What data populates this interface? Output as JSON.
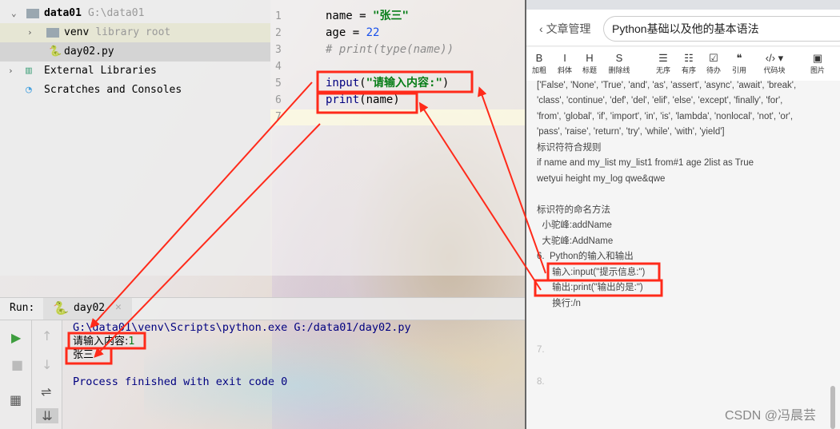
{
  "project": {
    "root": "data01",
    "root_path": "G:\\data01",
    "venv": "venv",
    "venv_hint": "library root",
    "file": "day02.py",
    "ext_libs": "External Libraries",
    "scratches": "Scratches and Consoles"
  },
  "editor": {
    "line_numbers": [
      "1",
      "2",
      "3",
      "4",
      "5",
      "6",
      "7"
    ],
    "lines": [
      {
        "a": "name = ",
        "b": "\"张三\""
      },
      {
        "a": "age = ",
        "b": "22"
      },
      {
        "c": "# print(type(name))"
      },
      {},
      {
        "fn": "input",
        "p": "(",
        "s": "\"请输入内容:\"",
        "q": ")"
      },
      {
        "fn": "print",
        "p": "(name)"
      }
    ]
  },
  "run": {
    "label": "Run:",
    "tab": "day02",
    "cmd": "G:\\data01\\venv\\Scripts\\python.exe G:/data01/day02.py",
    "prompt": "请输入内容:",
    "input": "1",
    "output": "张三",
    "exit": "Process finished with exit code 0"
  },
  "blog": {
    "back": "文章管理",
    "title": "Python基础以及他的基本语法",
    "tools": [
      {
        "i": "B",
        "l": "加粗"
      },
      {
        "i": "I",
        "l": "斜体"
      },
      {
        "i": "H",
        "l": "标题"
      },
      {
        "i": "S",
        "l": "删除线"
      },
      {
        "i": "☰",
        "l": "无序"
      },
      {
        "i": "☷",
        "l": "有序"
      },
      {
        "i": "☑",
        "l": "待办"
      },
      {
        "i": "❝",
        "l": "引用"
      },
      {
        "i": "‹/› ▾",
        "l": "代码块"
      },
      {
        "i": "▣",
        "l": "图片"
      }
    ],
    "lines": [
      "['False', 'None', 'True', 'and', 'as', 'assert', 'async', 'await', 'break',",
      "'class', 'continue', 'def', 'del', 'elif', 'else', 'except', 'finally', 'for',",
      "'from', 'global', 'if', 'import', 'in', 'is', 'lambda', 'nonlocal', 'not', 'or',",
      "'pass', 'raise', 'return', 'try', 'while', 'with', 'yield']",
      "标识符符合规则",
      "if name and my_list my_list1 from#1 age 2list as True",
      "wetyui height my_log qwe&qwe",
      "",
      "标识符的命名方法",
      "  小驼峰:addName",
      "  大驼峰:AddName",
      "6.  Python的输入和输出",
      "      输入:input(\"提示信息:\")",
      "      输出:print(\"输出的是:\")",
      "      换行:/n"
    ],
    "n7": "7.",
    "n8": "8.",
    "watermark": "CSDN @冯晨芸"
  },
  "colors": {
    "annotation": "#ff2a1a",
    "string": "#067d17",
    "keyword_fn": "#000080",
    "number": "#1750eb"
  }
}
